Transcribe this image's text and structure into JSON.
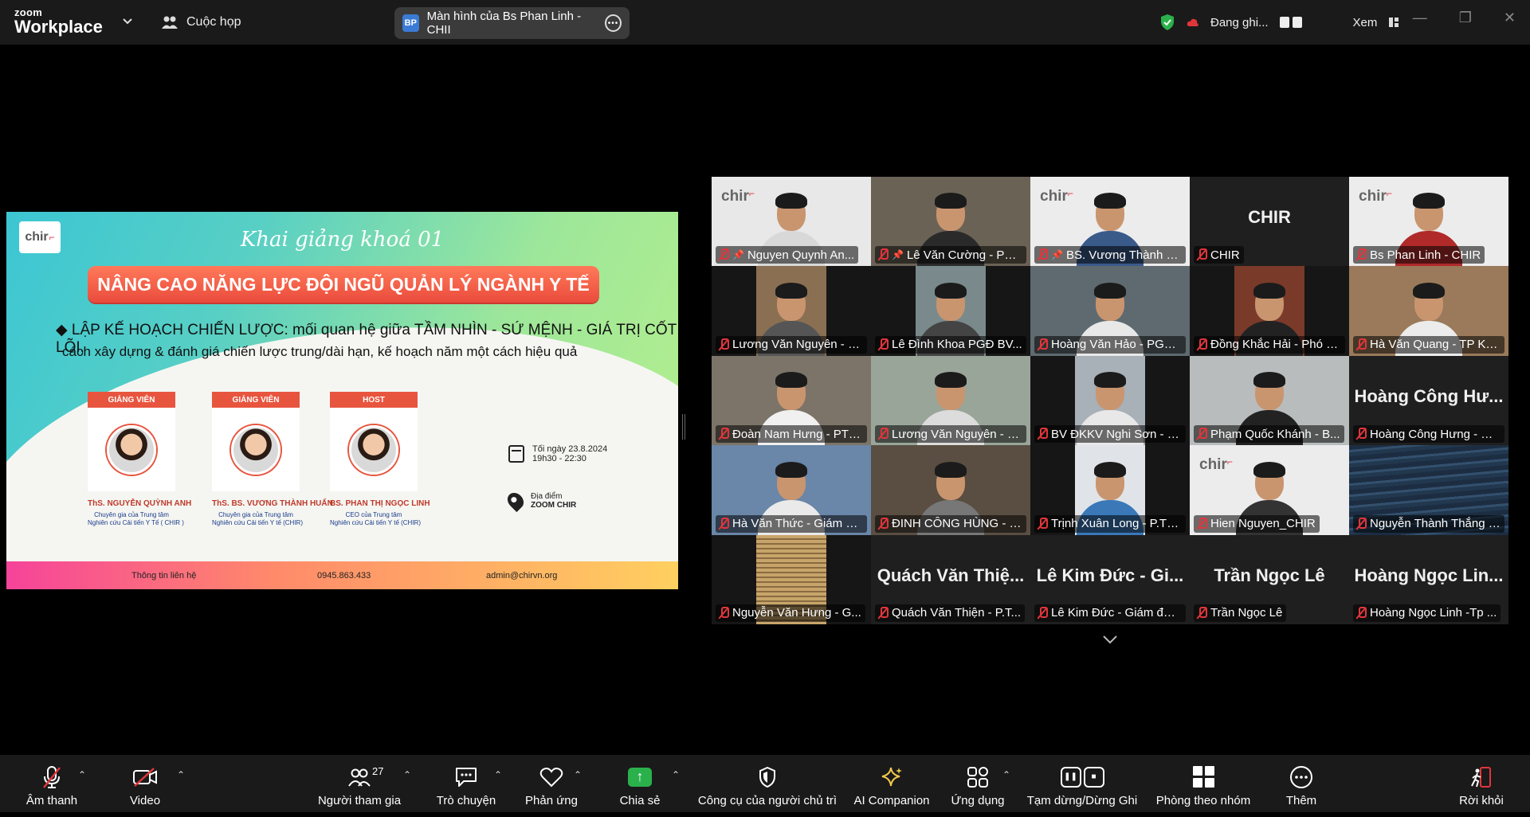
{
  "topbar": {
    "brand_small": "zoom",
    "brand_large": "Workplace",
    "meeting_menu": "Cuộc họp",
    "share_avatar": "BP",
    "share_title": "Màn hình của Bs Phan Linh - CHII",
    "recording_status": "Đang ghi...",
    "view_label": "Xem"
  },
  "slide": {
    "logo": "chir",
    "script_title": "Khai giảng khoá 01",
    "banner": "NÂNG CAO NĂNG LỰC ĐỘI NGŨ QUẢN LÝ NGÀNH Y TẾ",
    "line1": "◆  LẬP KẾ HOẠCH CHIẾN LƯỢC: mối quan hệ giữa TẦM NHÌN - SỨ MỆNH - GIÁ TRỊ CỐT LÕI,",
    "line2": "cách xây dựng & đánh giá  chiến lược trung/dài hạn, kế hoạch năm một cách hiệu quả",
    "speakers": [
      {
        "tag": "GIẢNG VIÊN",
        "name": "ThS. NGUYỄN QUỲNH ANH",
        "desc1": "Chuyên gia của Trung tâm",
        "desc2": "Nghiên cứu Cải tiến Y Tế ( CHIR )"
      },
      {
        "tag": "GIẢNG VIÊN",
        "name": "ThS. BS. VƯƠNG THÀNH HUẤN",
        "desc1": "Chuyên gia của Trung tâm",
        "desc2": "Nghiên cứu Cải tiến Y tế (CHIR)"
      },
      {
        "tag": "HOST",
        "name": "BS. PHAN THỊ NGỌC LINH",
        "desc1": "CEO của Trung tâm",
        "desc2": "Nghiên cứu Cải tiến Y tế (CHIR)"
      }
    ],
    "time1": "Tối ngày 23.8.2024",
    "time2": "19h30 - 22:30",
    "place_label": "Địa điểm",
    "place_value": "ZOOM CHIR",
    "footer_contact": "Thông tin liên hệ",
    "footer_phone": "0945.863.433",
    "footer_email": "admin@chirvn.org"
  },
  "participants": [
    {
      "label": "Nguyen Quynh An...",
      "bg": "#e8e8e8",
      "shirt": "#d8d8d8",
      "chir": true,
      "pinned": true
    },
    {
      "label": "Lê Văn Cường - PGĐ - ...",
      "bg": "#6b6256",
      "shirt": "#2a2a2a",
      "pinned": true,
      "active": true
    },
    {
      "label": "BS. Vương Thành H...",
      "bg": "#ececec",
      "shirt": "#3a5a8a",
      "chir": true,
      "pinned": true
    },
    {
      "label": "CHIR",
      "big": "CHIR",
      "bg": "#1f1f1f"
    },
    {
      "label": "Bs Phan Linh - CHIR",
      "bg": "#ececec",
      "shirt": "#b02a2a",
      "chir": true
    },
    {
      "label": "Lương Văn Nguyên - P...",
      "bg": "#8a6f52",
      "shirt": "#555",
      "narrow": true
    },
    {
      "label": "Lê Đình Khoa PGĐ BV...",
      "bg": "#7a8a8c",
      "shirt": "#444",
      "narrow": true
    },
    {
      "label": "Hoàng Văn Hảo - PGĐ ...",
      "bg": "#5f6a70",
      "shirt": "#e8e8e8"
    },
    {
      "label": "Đồng Khắc Hải - Phó G...",
      "bg": "#7a3a2a",
      "shirt": "#222",
      "narrow": true
    },
    {
      "label": "Hà Văn Quang - TP KH...",
      "bg": "#9a7a5a",
      "shirt": "#ececec"
    },
    {
      "label": "Đoàn Nam Hưng - PTC...",
      "bg": "#7c7468",
      "shirt": "#f0f0f0"
    },
    {
      "label": "Lương Văn Nguyên - PGĐ...",
      "bg": "#9aa59a",
      "shirt": "#dcdcdc"
    },
    {
      "label": "BV ĐKKV Nghi Sơn - P...",
      "bg": "#a8b0b8",
      "shirt": "#e8e8e8",
      "narrow": true
    },
    {
      "label": "Phạm Quốc Khánh - B...",
      "bg": "#b8bcbc",
      "shirt": "#222"
    },
    {
      "label": "Hoàng Công Hưng - Gi...",
      "big": "Hoàng Công Hư...",
      "bg": "#1f1f1f"
    },
    {
      "label": "Hà Văn Thức - Giám đố...",
      "bg": "#6a86a8",
      "shirt": "#eaeaea"
    },
    {
      "label": "ĐINH CÔNG HÙNG - B...",
      "bg": "#5a4e42",
      "shirt": "#777"
    },
    {
      "label": "Trịnh Xuân Long - P.TP...",
      "bg": "#e0e4e8",
      "shirt": "#3a78b8",
      "narrow": true
    },
    {
      "label": "Hien Nguyen_CHIR",
      "bg": "#ececec",
      "shirt": "#333",
      "chir": true
    },
    {
      "label": "Nguyễn Thành Thắng -...",
      "bg": "#2a3e55",
      "ocean": true
    },
    {
      "label": "Nguyễn Văn Hưng - G...",
      "bg": "#8a6a40",
      "narrow": true,
      "blinds": true
    },
    {
      "label": "Quách Văn Thiện - P.T...",
      "big": "Quách Văn Thiệ...",
      "bg": "#1f1f1f"
    },
    {
      "label": "Lê Kim Đức - Giám đốc...",
      "big": "Lê Kim Đức - Gi...",
      "bg": "#1f1f1f"
    },
    {
      "label": "Trần Ngọc Lê",
      "big": "Trần Ngọc Lê",
      "bg": "#1f1f1f"
    },
    {
      "label": "Hoàng Ngọc Linh -Tp ...",
      "big": "Hoàng Ngọc Lin...",
      "bg": "#1f1f1f"
    }
  ],
  "toolbar": {
    "audio": "Âm thanh",
    "video": "Video",
    "participants": "Người tham gia",
    "participant_count": "27",
    "chat": "Trò chuyện",
    "reactions": "Phản ứng",
    "share": "Chia sẻ",
    "host_tools": "Công cụ của người chủ trì",
    "ai_companion": "AI Companion",
    "apps": "Ứng dụng",
    "pause_record": "Tạm dừng/Dừng Ghi",
    "breakout": "Phòng theo nhóm",
    "more": "Thêm",
    "leave": "Rời khỏi"
  },
  "colors": {
    "accent_green": "#2fd06a",
    "share_green": "#2bb14b",
    "mute_red": "#e0363b",
    "leave_red": "#e0363b"
  }
}
